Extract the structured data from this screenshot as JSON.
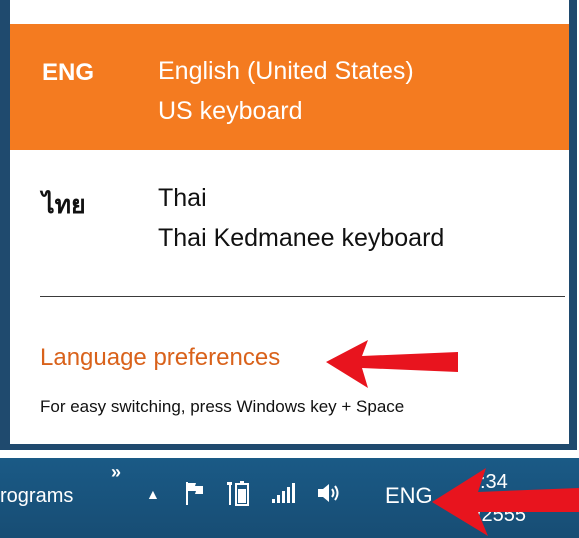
{
  "flyout": {
    "selected": {
      "code": "ENG",
      "language": "English (United States)",
      "keyboard": "US keyboard"
    },
    "thai": {
      "code": "ไทย",
      "language": "Thai",
      "keyboard": "Thai Kedmanee keyboard"
    },
    "preferences_link": "Language preferences",
    "hint": "For easy switching, press Windows key + Space"
  },
  "taskbar": {
    "programs_label": "rograms",
    "chevron": "»",
    "show_hidden": "▲",
    "input_indicator": "ENG",
    "time": ":34",
    "date": "/2555",
    "tray_icons": [
      "flag-icon",
      "power-icon",
      "network-icon",
      "volume-icon"
    ]
  },
  "colors": {
    "accent": "#f47b20",
    "link": "#d9621b",
    "taskbar": "#1a5a86",
    "annotation": "#e8141e"
  }
}
